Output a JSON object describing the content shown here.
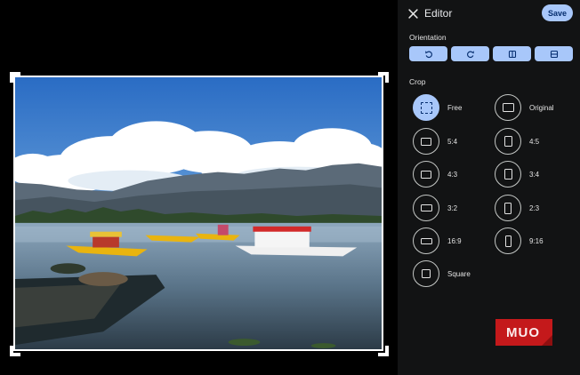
{
  "editor": {
    "title": "Editor",
    "save_label": "Save"
  },
  "orientation": {
    "label": "Orientation",
    "buttons": [
      {
        "name": "rotate-counterclockwise"
      },
      {
        "name": "rotate-clockwise"
      },
      {
        "name": "flip-horizontal"
      },
      {
        "name": "flip-vertical"
      }
    ]
  },
  "crop": {
    "label": "Crop",
    "selected": "Free",
    "options": [
      {
        "label": "Free"
      },
      {
        "label": "Original"
      },
      {
        "label": "5:4"
      },
      {
        "label": "4:5"
      },
      {
        "label": "4:3"
      },
      {
        "label": "3:4"
      },
      {
        "label": "3:2"
      },
      {
        "label": "2:3"
      },
      {
        "label": "16:9"
      },
      {
        "label": "9:16"
      },
      {
        "label": "Square"
      }
    ]
  },
  "watermark": {
    "text": "MUO"
  },
  "colors": {
    "accent": "#a8c7fa",
    "panel": "#121314",
    "watermark": "#c4191b"
  }
}
